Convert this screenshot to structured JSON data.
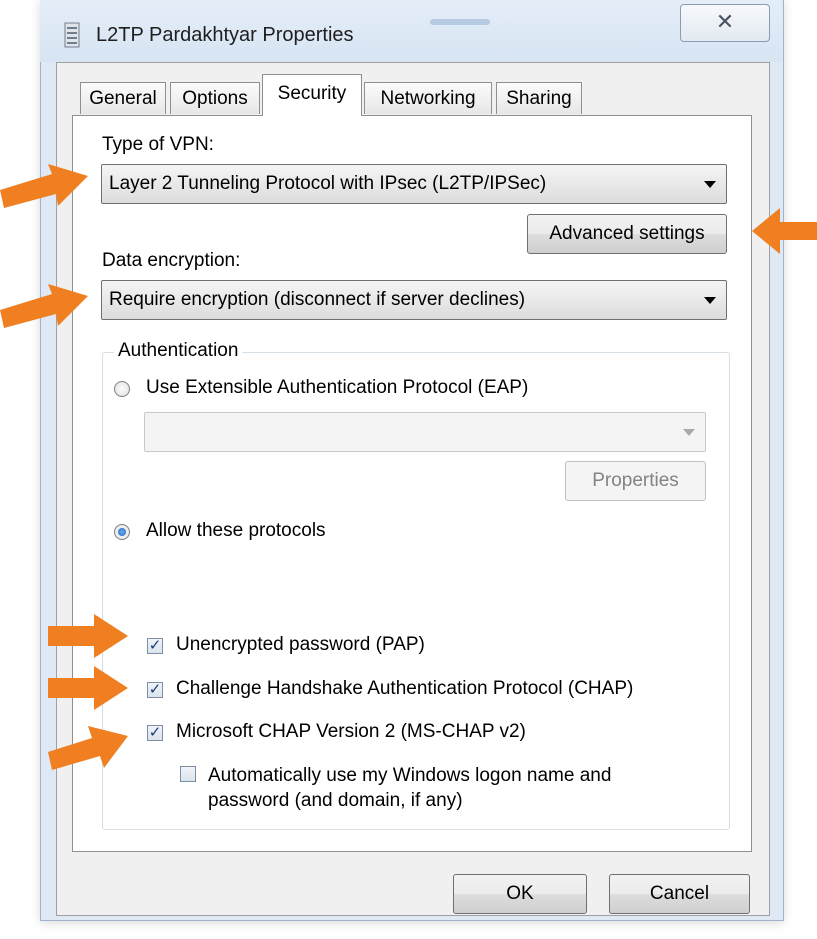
{
  "window": {
    "title": "L2TP Pardakhtyar Properties",
    "close_glyph": "✕"
  },
  "tabs": [
    {
      "label": "General",
      "active": false
    },
    {
      "label": "Options",
      "active": false
    },
    {
      "label": "Security",
      "active": true
    },
    {
      "label": "Networking",
      "active": false
    },
    {
      "label": "Sharing",
      "active": false
    }
  ],
  "security": {
    "vpn_type_label": "Type of VPN:",
    "vpn_type_value": "Layer 2 Tunneling Protocol with IPsec (L2TP/IPSec)",
    "advanced_settings_label": "Advanced settings",
    "encryption_label": "Data encryption:",
    "encryption_value": "Require encryption (disconnect if server declines)",
    "authentication": {
      "group_title": "Authentication",
      "eap_radio_label": "Use Extensible Authentication Protocol (EAP)",
      "eap_selected": false,
      "eap_combo_value": "",
      "eap_properties_label": "Properties",
      "allow_protocols_label": "Allow these protocols",
      "allow_selected": true,
      "protocols": {
        "pap_label": "Unencrypted password (PAP)",
        "pap_checked": true,
        "chap_label": "Challenge Handshake Authentication Protocol (CHAP)",
        "chap_checked": true,
        "mschap_label": "Microsoft CHAP Version 2 (MS-CHAP v2)",
        "mschap_checked": true,
        "autologon_label_line1": "Automatically use my Windows logon name and",
        "autologon_label_line2": "password (and domain, if any)",
        "autologon_checked": false
      }
    }
  },
  "footer": {
    "ok_label": "OK",
    "cancel_label": "Cancel"
  },
  "annotations": {
    "arrow_color": "#f07f22",
    "count": 6
  }
}
